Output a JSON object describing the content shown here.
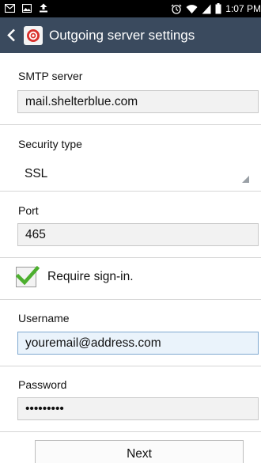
{
  "status_bar": {
    "time": "1:07 PM",
    "icons": [
      "mail-icon",
      "gallery-icon",
      "upload-icon",
      "alarm-icon",
      "wifi-icon",
      "signal-icon",
      "battery-icon"
    ]
  },
  "action_bar": {
    "title": "Outgoing server settings",
    "icon": "mail-app-icon"
  },
  "form": {
    "smtp_server": {
      "label": "SMTP server",
      "value": "mail.shelterblue.com"
    },
    "security_type": {
      "label": "Security type",
      "value": "SSL"
    },
    "port": {
      "label": "Port",
      "value": "465"
    },
    "require_signin": {
      "label": "Require sign-in.",
      "checked": true
    },
    "username": {
      "label": "Username",
      "value": "youremail@address.com"
    },
    "password": {
      "label": "Password",
      "value": "•••••••••"
    }
  },
  "buttons": {
    "next": "Next"
  },
  "colors": {
    "action_bar": "#3a4a5e",
    "status_bar": "#000000",
    "checkmark": "#4caf2e",
    "focus_field": "#eaf3fb"
  }
}
